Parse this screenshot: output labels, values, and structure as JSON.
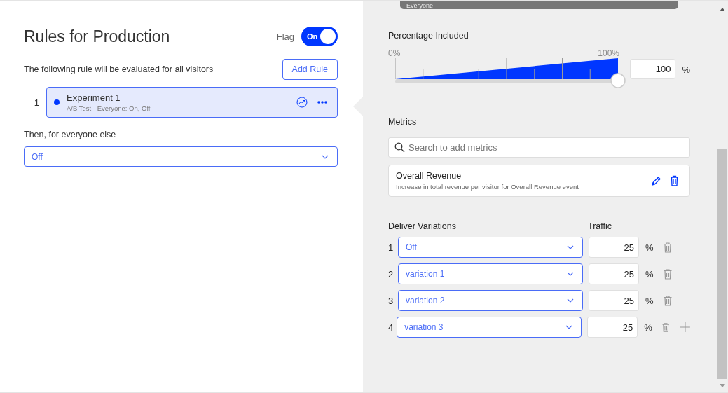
{
  "title": "Rules for Production",
  "flag": {
    "label": "Flag",
    "on": true,
    "text": "On"
  },
  "intro": "The following rule will be evaluated for all visitors",
  "add_rule": "Add Rule",
  "rules": [
    {
      "number": "1",
      "name": "Experiment 1",
      "summary": "A/B Test - Everyone: On, Off",
      "selected": true
    }
  ],
  "fallback": {
    "label": "Then, for everyone else",
    "value": "Off"
  },
  "audience_bar": "Everyone",
  "percentage": {
    "label": "Percentage Included",
    "min": "0%",
    "max": "100%",
    "level": 1.0,
    "value": "100",
    "unit": "%"
  },
  "metrics": {
    "label": "Metrics",
    "placeholder": "Search to add metrics",
    "items": [
      {
        "name": "Overall Revenue",
        "description": "Increase in total revenue per visitor for Overall Revenue event"
      }
    ]
  },
  "variations": {
    "label": "Deliver Variations",
    "traffic_label": "Traffic",
    "rows": [
      {
        "number": "1",
        "value": "Off",
        "traffic": "25",
        "unit": "%"
      },
      {
        "number": "2",
        "value": "variation 1",
        "traffic": "25",
        "unit": "%"
      },
      {
        "number": "3",
        "value": "variation 2",
        "traffic": "25",
        "unit": "%"
      },
      {
        "number": "4",
        "value": "variation 3",
        "traffic": "25",
        "unit": "%"
      }
    ]
  }
}
